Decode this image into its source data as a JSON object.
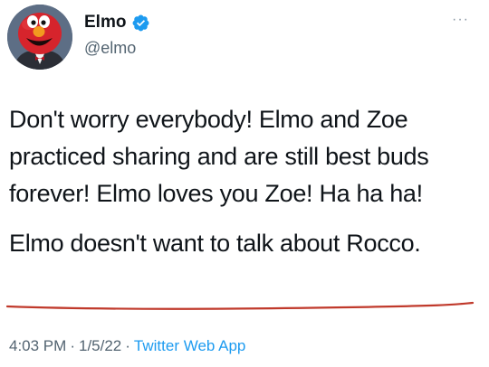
{
  "author": {
    "display_name": "Elmo",
    "handle": "@elmo",
    "verified": true,
    "avatar_icon": "elmo-avatar",
    "verified_icon": "verified-badge-icon",
    "verified_color": "#1d9bf0"
  },
  "more_icon": "more-horizontal-icon",
  "more_glyph": "···",
  "tweet": {
    "paragraph_1": "Don't worry everybody! Elmo and Zoe practiced sharing and are still best buds forever! Elmo loves you Zoe! Ha ha ha!",
    "paragraph_2": "Elmo doesn't want to talk about Rocco.",
    "underline_color": "#c0392b"
  },
  "meta": {
    "time": "4:03 PM",
    "separator": "·",
    "date": "1/5/22",
    "source": "Twitter Web App",
    "source_color": "#1d9bf0"
  }
}
